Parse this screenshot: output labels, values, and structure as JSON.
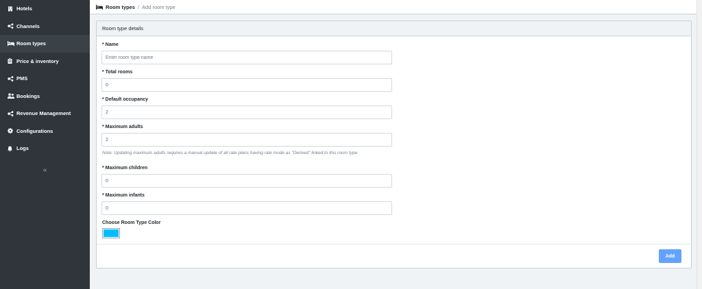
{
  "sidebar": {
    "items": [
      {
        "label": "Hotels",
        "icon": "hotel-icon",
        "active": false
      },
      {
        "label": "Channels",
        "icon": "share-nodes-icon",
        "active": false
      },
      {
        "label": "Room types",
        "icon": "bed-icon",
        "active": true
      },
      {
        "label": "Price & inventory",
        "icon": "clipboard-icon",
        "active": false
      },
      {
        "label": "PMS",
        "icon": "share-nodes-icon",
        "active": false
      },
      {
        "label": "Bookings",
        "icon": "users-icon",
        "active": false
      },
      {
        "label": "Revenue Management",
        "icon": "share-nodes-icon",
        "active": false
      },
      {
        "label": "Configurations",
        "icon": "gear-icon",
        "active": false
      },
      {
        "label": "Logs",
        "icon": "bell-icon",
        "active": false
      }
    ],
    "collapse_label": "«"
  },
  "breadcrumb": {
    "parent": "Room types",
    "separator": "/",
    "current": "Add room type"
  },
  "card": {
    "title": "Room type details"
  },
  "form": {
    "name": {
      "label": "* Name",
      "value": "",
      "placeholder": "Enter room type name"
    },
    "total_rooms": {
      "label": "* Total rooms",
      "value": "0"
    },
    "default_occupancy": {
      "label": "* Default occupancy",
      "value": "2"
    },
    "maximum_adults": {
      "label": "* Maximum adults",
      "value": "2"
    },
    "adults_note": "Note: Updating maximum adults requires a manual update of all rate plans having rate mode as \"Derived\" linked to this room type.",
    "maximum_children": {
      "label": "* Maximum children",
      "value": "0"
    },
    "maximum_infants": {
      "label": "* Maximum infants",
      "value": "0"
    },
    "color": {
      "label": "Choose Room Type Color",
      "value": "#00bfff"
    },
    "submit_label": "Add"
  },
  "colors": {
    "sidebar_bg": "#2f353a",
    "active_item": "#3a4248",
    "primary_button": "#63a3ff"
  }
}
